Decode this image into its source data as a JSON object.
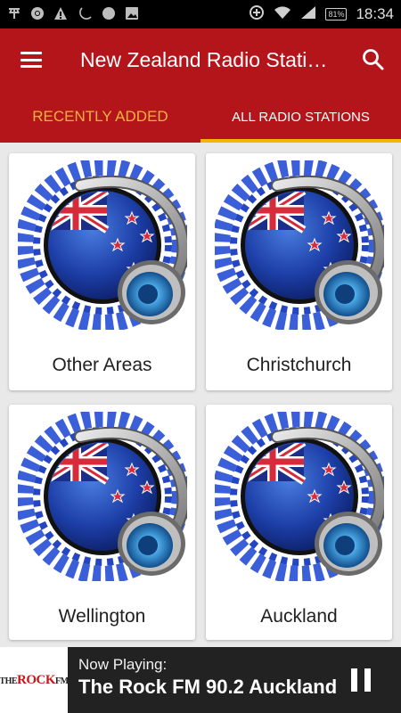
{
  "status_bar": {
    "time": "18:34",
    "battery": "81%",
    "left_icons": [
      "antenna-icon",
      "chrome-icon",
      "warning-icon",
      "night-icon",
      "circle-icon",
      "image-icon"
    ],
    "right_icons": [
      "data-saver-icon",
      "wifi-icon",
      "signal-icon",
      "battery-icon"
    ]
  },
  "app_bar": {
    "title": "New Zealand Radio Stati…",
    "menu_icon": "hamburger-menu-icon",
    "search_icon": "search-icon",
    "color": "#b3151b"
  },
  "tabs": [
    {
      "label": "RECENTLY ADDED",
      "selected": false,
      "color": "#f5b13d"
    },
    {
      "label": "ALL RADIO STATIONS",
      "selected": true,
      "color": "#ffffff"
    }
  ],
  "tab_indicator_color": "#f4b400",
  "categories": [
    {
      "label": "Other Areas",
      "icon": "nz-flag-headphones-icon"
    },
    {
      "label": "Christchurch",
      "icon": "nz-flag-headphones-icon"
    },
    {
      "label": "Wellington",
      "icon": "nz-flag-headphones-icon"
    },
    {
      "label": "Auckland",
      "icon": "nz-flag-headphones-icon"
    }
  ],
  "player": {
    "now_playing_label": "Now Playing:",
    "station": "The Rock FM 90.2 Auckland",
    "logo_text": "THE ROCK FM",
    "logo_main": "ROCK",
    "logo_suffix": "FM",
    "logo_prefix": "THE",
    "pause_icon": "pause-icon"
  }
}
